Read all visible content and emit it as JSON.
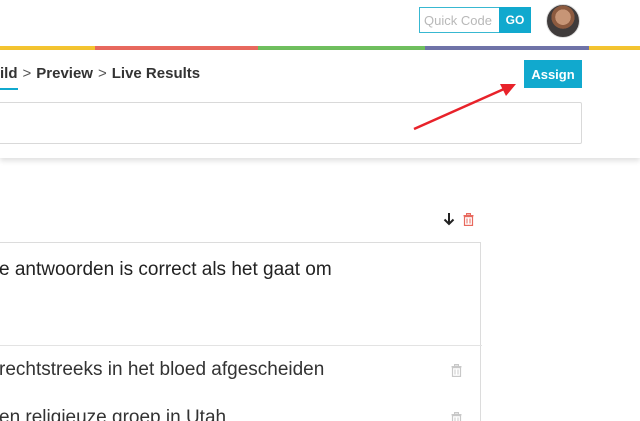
{
  "header": {
    "quickcode_placeholder": "Quick Code",
    "go_label": "GO"
  },
  "stripe_colors": [
    "#f4c430",
    "#e8695e",
    "#6fbf5e",
    "#6f73a8",
    "#f4c430"
  ],
  "breadcrumb": {
    "build": "ild",
    "sep1": ">",
    "preview": "Preview",
    "sep2": ">",
    "live_results": "Live Results"
  },
  "assign_label": "Assign",
  "question": {
    "text": "e antwoorden is correct als het gaat om",
    "answers": [
      "rechtstreeks in het bloed afgescheiden",
      "en religieuze groep in Utah"
    ]
  },
  "icons": {
    "move_down": "arrow-down-icon",
    "delete": "trash-icon"
  },
  "colors": {
    "accent": "#11a9ce",
    "annotation_arrow": "#e8222a",
    "delete_icon": "#e8695e"
  }
}
